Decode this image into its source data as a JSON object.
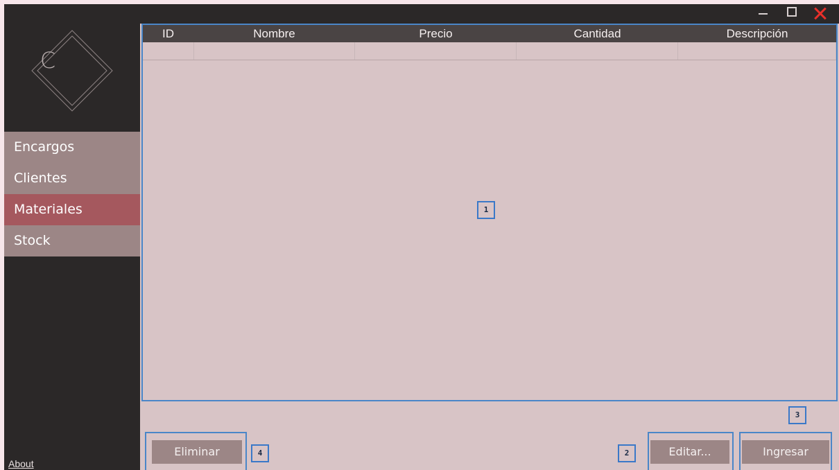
{
  "window": {
    "controls": [
      "minimize-icon",
      "maximize-icon",
      "close-icon"
    ],
    "close_color": "#e8302a"
  },
  "sidebar": {
    "logo_letter": "C",
    "items": [
      {
        "label": "Encargos"
      },
      {
        "label": "Clientes"
      },
      {
        "label": "Materiales",
        "active": true
      },
      {
        "label": "Stock"
      }
    ],
    "about": "About"
  },
  "table": {
    "columns": [
      "ID",
      "Nombre",
      "Precio",
      "Cantidad",
      "Descripción"
    ],
    "rows": []
  },
  "buttons": {
    "delete": "Eliminar",
    "edit": "Editar...",
    "insert": "Ingresar"
  },
  "annotations": [
    "1",
    "2",
    "3",
    "4"
  ],
  "colors": {
    "sidebar_bg": "#2b2828",
    "content_bg": "#d8c4c6",
    "nav_item": "#9c8686",
    "nav_active": "#a5585e",
    "accent_outline": "#4a86c8"
  }
}
